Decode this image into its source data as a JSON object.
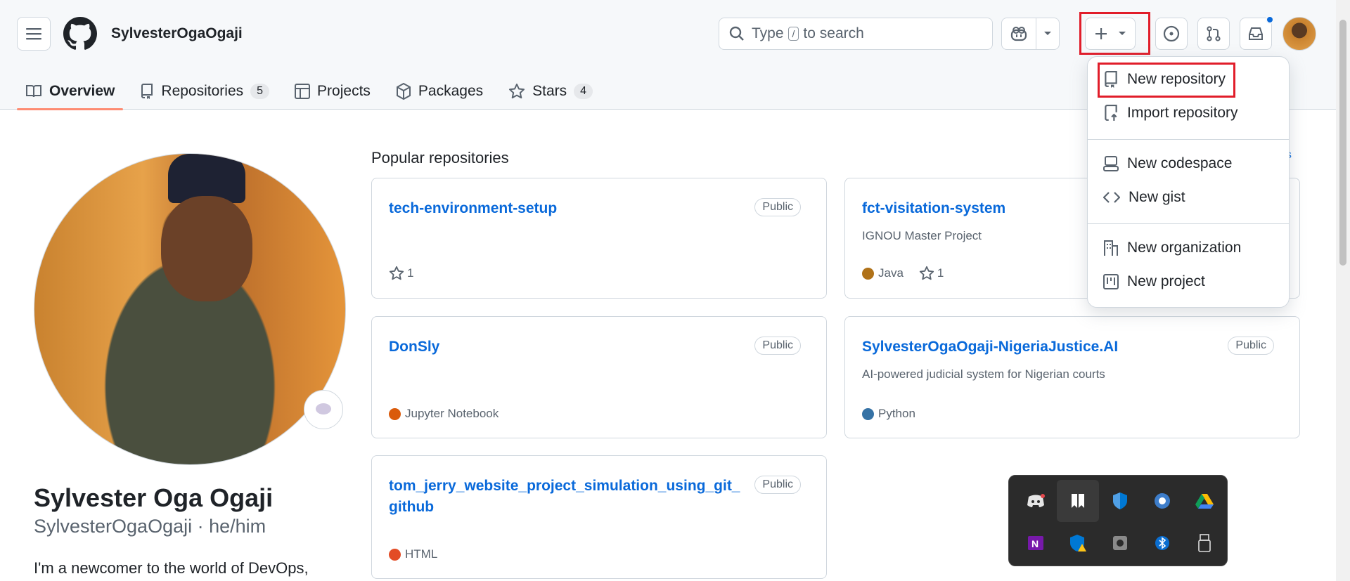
{
  "header": {
    "username": "SylvesterOgaOgaji",
    "search_prefix": "Type",
    "search_key": "/",
    "search_suffix": "to search"
  },
  "tabs": [
    {
      "label": "Overview"
    },
    {
      "label": "Repositories",
      "count": "5"
    },
    {
      "label": "Projects"
    },
    {
      "label": "Packages"
    },
    {
      "label": "Stars",
      "count": "4"
    }
  ],
  "profile": {
    "full_name": "Sylvester Oga Ogaji",
    "login_line": "SylvesterOgaOgaji · he/him",
    "bio": "I'm a newcomer to the world of DevOps,"
  },
  "popular": {
    "title": "Popular repositories",
    "customize_partial": "ns"
  },
  "repos": [
    {
      "name": "tech-environment-setup",
      "visibility": "Public",
      "stars": "1"
    },
    {
      "name": "fct-visitation-system",
      "desc": "IGNOU Master Project",
      "language": "Java",
      "lang_color": "#b07219",
      "stars": "1"
    },
    {
      "name": "DonSly",
      "visibility": "Public",
      "language": "Jupyter Notebook",
      "lang_color": "#DA5B0B"
    },
    {
      "name": "SylvesterOgaOgaji-NigeriaJustice.AI",
      "visibility": "Public",
      "desc": "AI-powered judicial system for Nigerian courts",
      "language": "Python",
      "lang_color": "#3572A5"
    },
    {
      "name": "tom_jerry_website_project_simulation_using_git_github",
      "visibility": "Public",
      "language": "HTML",
      "lang_color": "#e34c26"
    }
  ],
  "create_menu": {
    "items": [
      {
        "label": "New repository",
        "icon": "repo-icon"
      },
      {
        "label": "Import repository",
        "icon": "repo-push-icon"
      },
      {
        "label": "New codespace",
        "icon": "codespaces-icon"
      },
      {
        "label": "New gist",
        "icon": "code-icon"
      },
      {
        "label": "New organization",
        "icon": "organization-icon"
      },
      {
        "label": "New project",
        "icon": "table-icon"
      }
    ]
  },
  "colors": {
    "link": "#0969da",
    "highlight": "#e11d2a",
    "tab_underline": "#fd8c73",
    "notification": "#0969da"
  },
  "tray_icons": [
    "discord-icon",
    "bookmark-app-icon",
    "defender-icon",
    "key-app-icon",
    "google-drive-icon",
    "onenote-icon",
    "security-warning-icon",
    "camera-app-icon",
    "bluetooth-icon",
    "usb-icon"
  ]
}
